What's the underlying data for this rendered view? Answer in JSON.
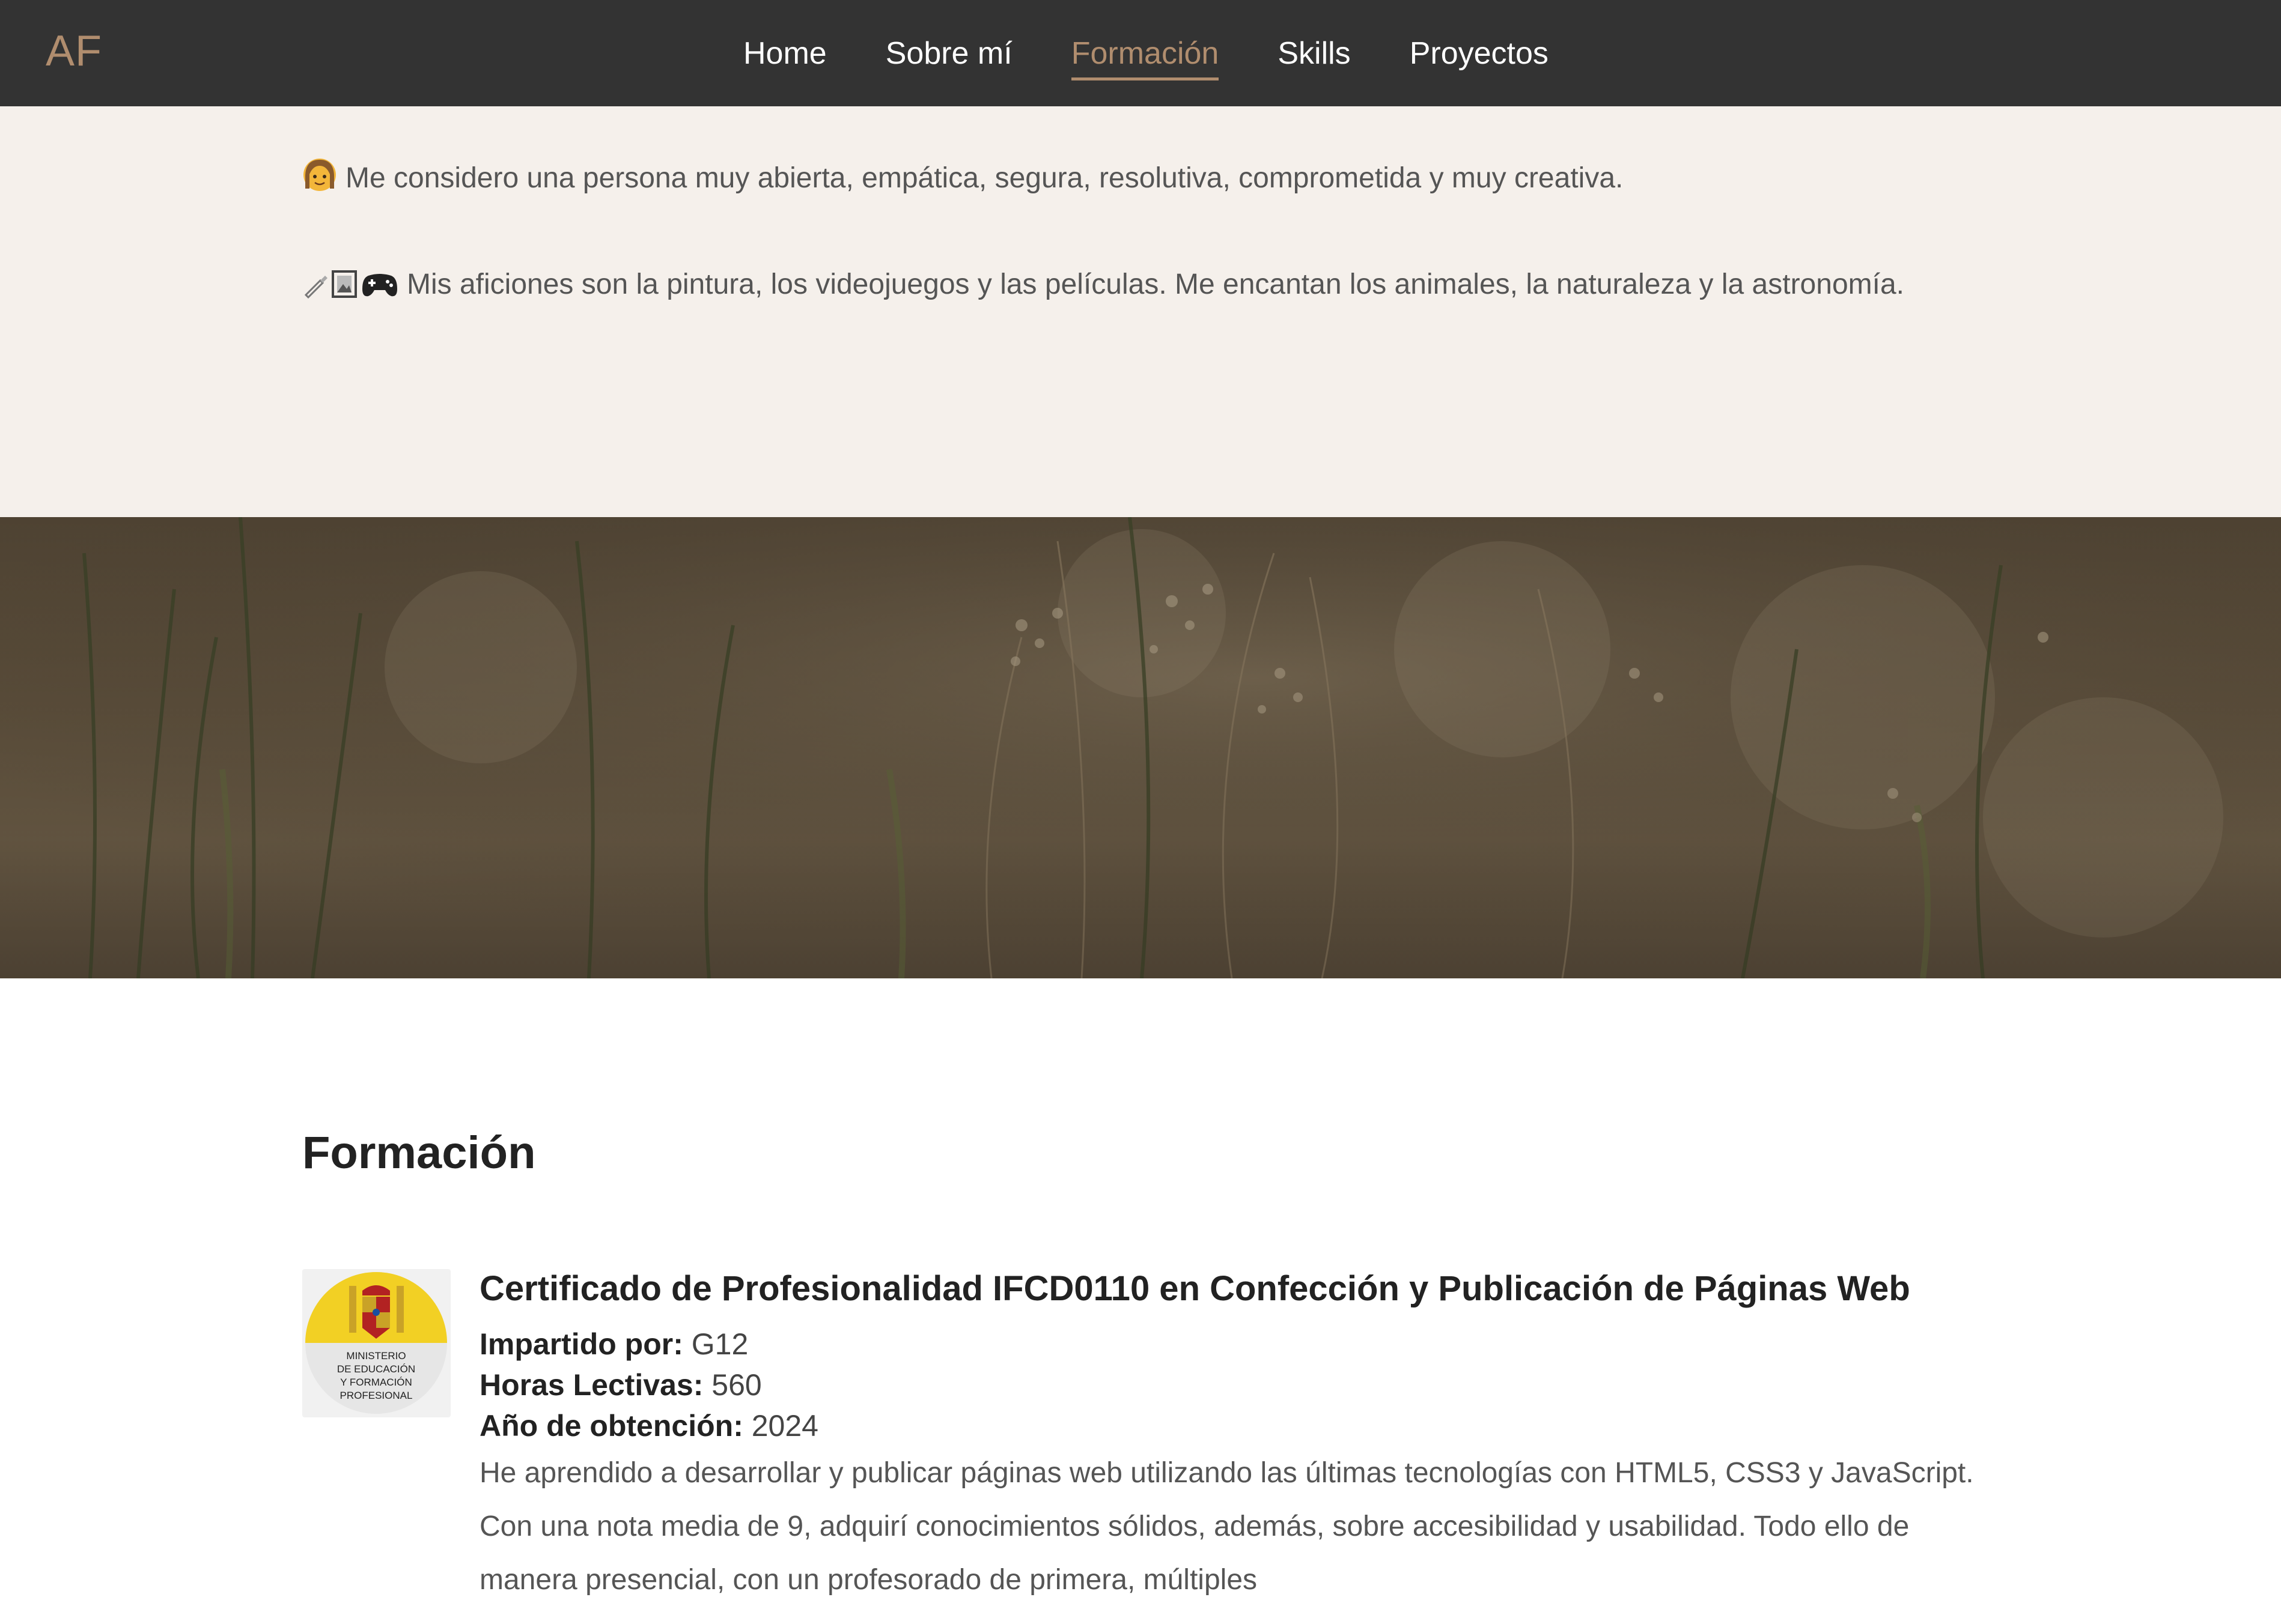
{
  "nav": {
    "logo": "AF",
    "items": [
      {
        "label": "Home",
        "active": false
      },
      {
        "label": "Sobre mí",
        "active": false
      },
      {
        "label": "Formación",
        "active": true
      },
      {
        "label": "Skills",
        "active": false
      },
      {
        "label": "Proyectos",
        "active": false
      }
    ]
  },
  "about": {
    "line1": "Me considero una persona muy abierta, empática, segura, resolutiva, comprometida y muy creativa.",
    "line2": "Mis aficiones son la pintura, los videojuegos y las películas. Me encantan los animales, la naturaleza y la astronomía."
  },
  "banner": {
    "icon": "grass-field-photo"
  },
  "formacion": {
    "title": "Formación",
    "course": {
      "logo_text": [
        "MINISTERIO",
        "DE EDUCACIÓN",
        "Y FORMACIÓN",
        "PROFESIONAL"
      ],
      "title": "Certificado de Profesionalidad IFCD0110 en Confección y Publicación de Páginas Web",
      "impartido_label": "Impartido por:",
      "impartido_value": "G12",
      "horas_label": "Horas Lectivas:",
      "horas_value": "560",
      "anio_label": "Año de obtención:",
      "anio_value": "2024",
      "description": "He aprendido a desarrollar y publicar páginas web utilizando las últimas tecnologías con HTML5, CSS3 y JavaScript. Con una nota media de 9, adquirí conocimientos sólidos, además, sobre accesibilidad y usabilidad. Todo ello de manera presencial, con un profesorado de primera, múltiples"
    }
  },
  "colors": {
    "nav_bg": "#333333",
    "accent": "#b08d6e",
    "about_bg": "#f5f0eb"
  }
}
